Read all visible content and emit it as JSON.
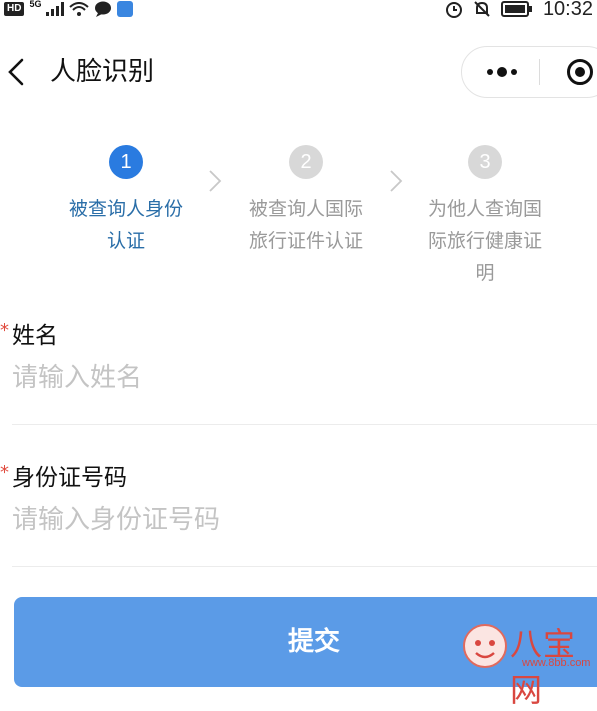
{
  "status_bar": {
    "hd": "HD",
    "network": "5G",
    "time": "10:32"
  },
  "header": {
    "title": "人脸识别",
    "icons": [
      "back-icon",
      "more-icon",
      "close-miniprogram-icon"
    ]
  },
  "steps": [
    {
      "number": "1",
      "label_line1": "被查询人身份",
      "label_line2": "认证",
      "label_line3": "",
      "state": "active"
    },
    {
      "number": "2",
      "label_line1": "被查询人国际",
      "label_line2": "旅行证件认证",
      "label_line3": "",
      "state": "inactive"
    },
    {
      "number": "3",
      "label_line1": "为他人查询国",
      "label_line2": "际旅行健康证",
      "label_line3": "明",
      "state": "inactive"
    }
  ],
  "form": {
    "required_mark": "*",
    "name": {
      "label": "姓名",
      "placeholder": "请输入姓名",
      "value": ""
    },
    "id_number": {
      "label": "身份证号码",
      "placeholder": "请输入身份证号码",
      "value": ""
    }
  },
  "submit_label": "提交",
  "watermark": {
    "text": "八宝网",
    "url": "www.8bb.com"
  },
  "colors": {
    "active_step": "#2a7be0",
    "inactive_step": "#d8d8d8",
    "button": "#5b9be7",
    "required": "#e04b3e"
  }
}
